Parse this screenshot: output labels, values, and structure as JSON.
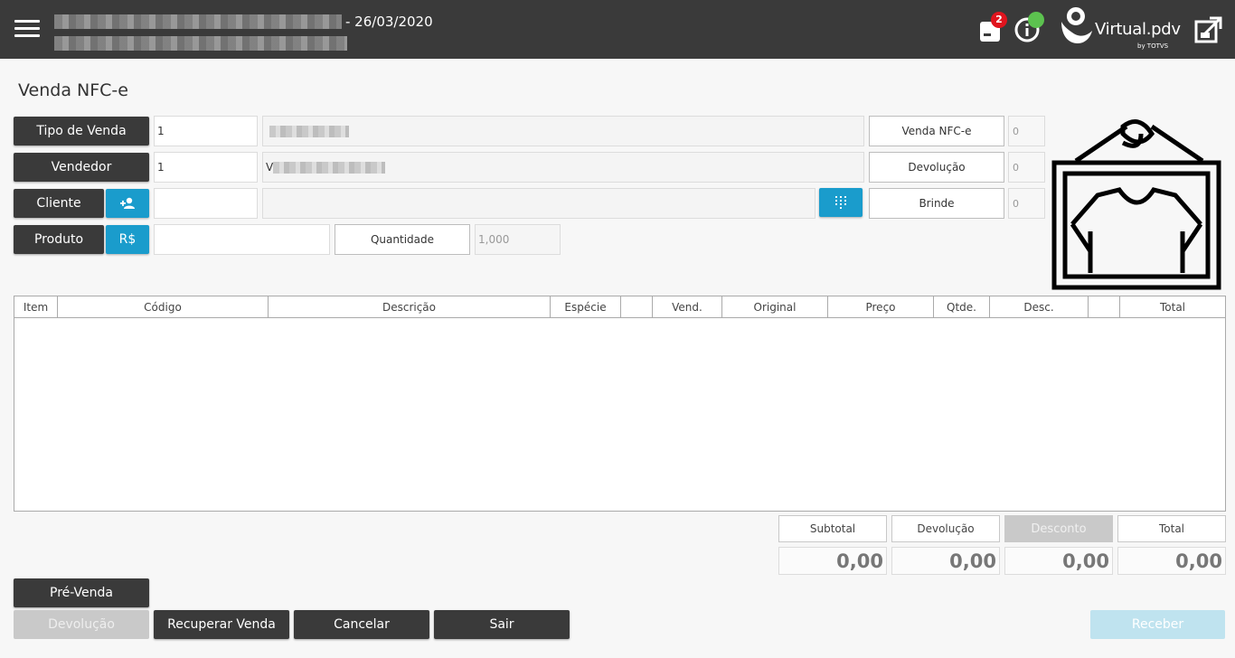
{
  "header": {
    "date_text": "- 26/03/2020",
    "notification_count": "2",
    "logo_text": "Virtual.pdv",
    "logo_sub": "by TOTVS",
    "icons": [
      "menu-icon",
      "cart-icon",
      "info-icon",
      "exit-icon"
    ]
  },
  "page_title": "Venda NFC-e",
  "form": {
    "tipo_venda_label": "Tipo de Venda",
    "tipo_venda_code": "1",
    "vendedor_label": "Vendedor",
    "vendedor_code": "1",
    "vendedor_desc_prefix": "V",
    "cliente_label": "Cliente",
    "produto_label": "Produto",
    "price_button": "R$",
    "quantidade_label": "Quantidade",
    "quantidade_value": "1,000"
  },
  "counters": [
    {
      "label": "Venda NFC-e",
      "value": "0"
    },
    {
      "label": "Devolução",
      "value": "0"
    },
    {
      "label": "Brinde",
      "value": "0"
    }
  ],
  "table": {
    "columns": [
      "Item",
      "Código",
      "Descrição",
      "Espécie",
      "",
      "Vend.",
      "Original",
      "Preço",
      "Qtde.",
      "Desc.",
      "",
      "Total"
    ],
    "rows": []
  },
  "totals": {
    "subtotal_label": "Subtotal",
    "subtotal_value": "0,00",
    "devolucao_label": "Devolução",
    "devolucao_value": "0,00",
    "desconto_label": "Desconto",
    "desconto_value": "0,00",
    "total_label": "Total",
    "total_value": "0,00"
  },
  "actions": {
    "pre_venda": "Pré-Venda",
    "devolucao": "Devolução",
    "recuperar_venda": "Recuperar Venda",
    "cancelar": "Cancelar",
    "sair": "Sair",
    "receber": "Receber"
  }
}
